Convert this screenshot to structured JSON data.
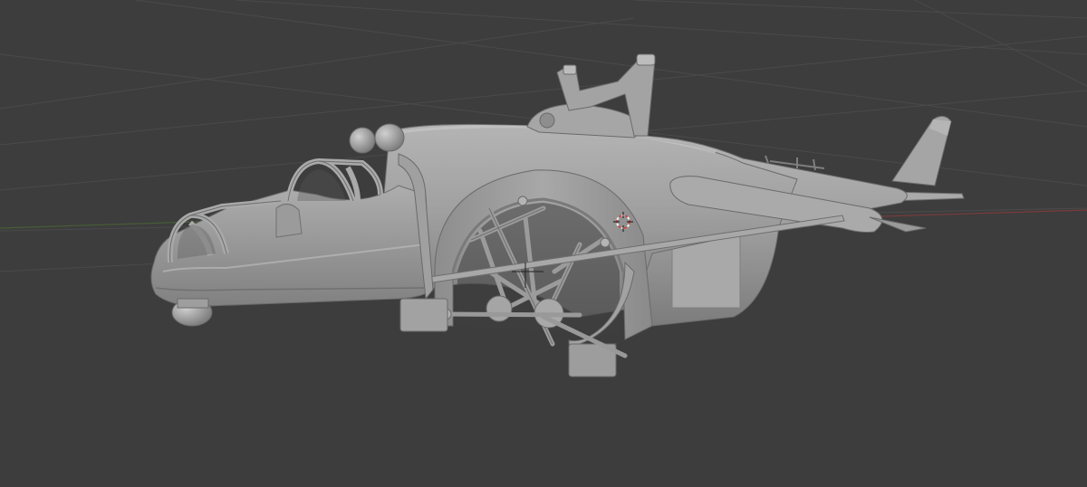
{
  "viewport": {
    "background": "#3d3d3d",
    "grid_color": "#4a4a4a",
    "x_axis_color": "#7a3b3b",
    "y_axis_color": "#4d6b34"
  },
  "scene": {
    "model_name": "hover-gunship-model",
    "shading": "solid",
    "model_base_color": "#9a9a9a",
    "model_highlight_color": "#b8b8b8",
    "model_shadow_color": "#6e6e6e",
    "cursor_icon": "3d-cursor-icon",
    "cursor_colors": [
      "#d04848",
      "#f0f0f0"
    ]
  }
}
